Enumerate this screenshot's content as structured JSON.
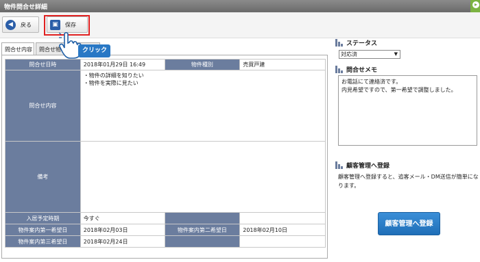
{
  "window": {
    "title": "物件問合せ詳細",
    "corner_glyph": "▸"
  },
  "toolbar": {
    "back_label": "戻る",
    "save_label": "保存"
  },
  "annotation": {
    "click_label": "クリック"
  },
  "tabs": [
    {
      "label": "問合せ内容"
    },
    {
      "label": "問合せ物件"
    }
  ],
  "detail": {
    "inquiry_date_label": "問合せ日時",
    "inquiry_date_value": "2018年01月29日 16:49",
    "property_type_label": "物件種別",
    "property_type_value": "売買戸建",
    "inquiry_content_label": "問合せ内容",
    "inquiry_content_items": [
      "・物件の詳細を知りたい",
      "・物件を実際に見たい"
    ],
    "remarks_label": "備考",
    "remarks_value": "",
    "move_in_label": "入居予定時期",
    "move_in_value": "今すぐ",
    "tour1_label": "物件案内第一希望日",
    "tour1_value": "2018年02月03日",
    "tour2_label": "物件案内第二希望日",
    "tour2_value": "2018年02月10日",
    "tour3_label": "物件案内第三希望日",
    "tour3_value": "2018年02月24日"
  },
  "status": {
    "heading": "ステータス",
    "selected": "対応済",
    "arrow": "▼"
  },
  "memo": {
    "heading": "問合せメモ",
    "lines": [
      "お電話にて連絡済です。",
      "内見希望ですので、第一希望で調整しました。"
    ]
  },
  "customer": {
    "heading": "顧客管理へ登録",
    "description": "顧客管理へ登録すると、追客メール・DM送信が簡単になります。",
    "button_label": "顧客管理へ登録"
  },
  "colors": {
    "header_cell": "#6b7d9e",
    "highlight": "#e02020",
    "cta": "#1f6fb8",
    "click_badge": "#2978c5"
  }
}
